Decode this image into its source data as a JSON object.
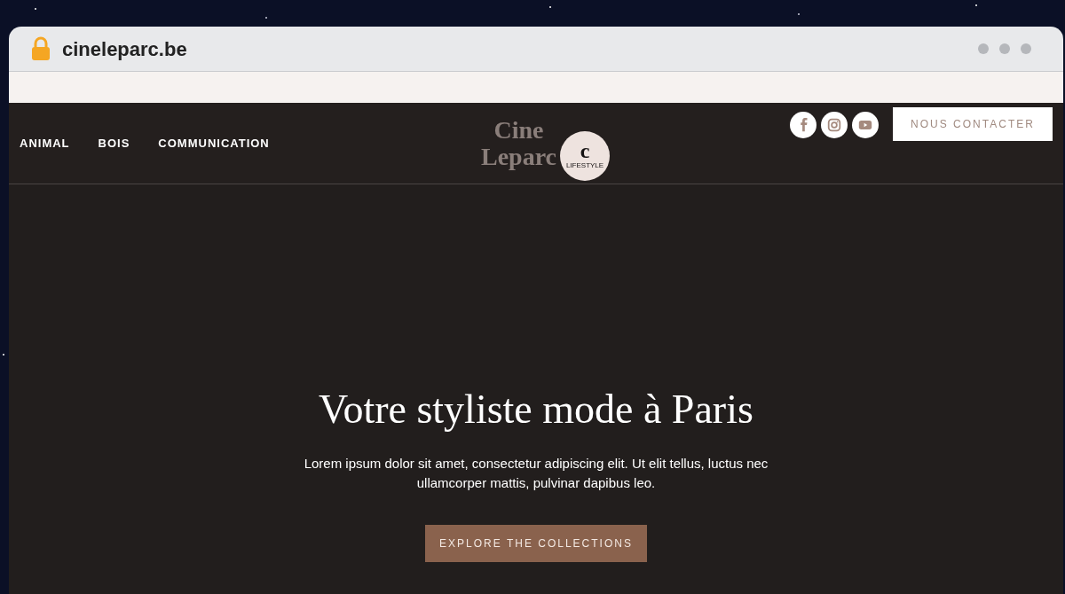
{
  "browser": {
    "address": "cineleparc.be"
  },
  "nav": {
    "items": [
      {
        "label": "ANIMAL"
      },
      {
        "label": "BOIS"
      },
      {
        "label": "COMMUNICATION"
      }
    ]
  },
  "logo": {
    "line_1": "Cine",
    "line_2": "Leparc",
    "badge_letter": "c",
    "badge_text": "LIFESTYLE"
  },
  "social": [
    {
      "kind": "facebook"
    },
    {
      "kind": "instagram"
    },
    {
      "kind": "youtube"
    }
  ],
  "contact_button": "NOUS CONTACTER",
  "hero": {
    "title": "Votre styliste mode à Paris",
    "text": "Lorem ipsum dolor sit amet, consectetur adipiscing elit. Ut elit tellus, luctus nec ullamcorper mattis, pulvinar dapibus leo.",
    "button": "EXPLORE THE COLLECTIONS"
  }
}
